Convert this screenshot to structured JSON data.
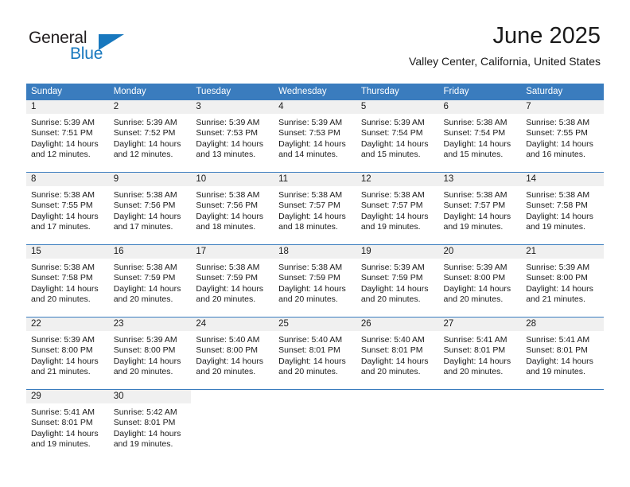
{
  "brand": {
    "name_part1": "General",
    "name_part2": "Blue",
    "triangle_icon": "triangle-icon"
  },
  "header": {
    "month_title": "June 2025",
    "location": "Valley Center, California, United States"
  },
  "calendar": {
    "weekday_headers": [
      "Sunday",
      "Monday",
      "Tuesday",
      "Wednesday",
      "Thursday",
      "Friday",
      "Saturday"
    ],
    "colors": {
      "header_background": "#3a7cbe",
      "header_text": "#ffffff",
      "daynum_background": "#f0f0f0",
      "cell_background": "#ffffff",
      "row_divider": "#3a7cbe",
      "brand_blue": "#1878be",
      "text": "#1a1a1a"
    },
    "weeks": [
      [
        {
          "day": "1",
          "sunrise": "Sunrise: 5:39 AM",
          "sunset": "Sunset: 7:51 PM",
          "daylight": "Daylight: 14 hours and 12 minutes."
        },
        {
          "day": "2",
          "sunrise": "Sunrise: 5:39 AM",
          "sunset": "Sunset: 7:52 PM",
          "daylight": "Daylight: 14 hours and 12 minutes."
        },
        {
          "day": "3",
          "sunrise": "Sunrise: 5:39 AM",
          "sunset": "Sunset: 7:53 PM",
          "daylight": "Daylight: 14 hours and 13 minutes."
        },
        {
          "day": "4",
          "sunrise": "Sunrise: 5:39 AM",
          "sunset": "Sunset: 7:53 PM",
          "daylight": "Daylight: 14 hours and 14 minutes."
        },
        {
          "day": "5",
          "sunrise": "Sunrise: 5:39 AM",
          "sunset": "Sunset: 7:54 PM",
          "daylight": "Daylight: 14 hours and 15 minutes."
        },
        {
          "day": "6",
          "sunrise": "Sunrise: 5:38 AM",
          "sunset": "Sunset: 7:54 PM",
          "daylight": "Daylight: 14 hours and 15 minutes."
        },
        {
          "day": "7",
          "sunrise": "Sunrise: 5:38 AM",
          "sunset": "Sunset: 7:55 PM",
          "daylight": "Daylight: 14 hours and 16 minutes."
        }
      ],
      [
        {
          "day": "8",
          "sunrise": "Sunrise: 5:38 AM",
          "sunset": "Sunset: 7:55 PM",
          "daylight": "Daylight: 14 hours and 17 minutes."
        },
        {
          "day": "9",
          "sunrise": "Sunrise: 5:38 AM",
          "sunset": "Sunset: 7:56 PM",
          "daylight": "Daylight: 14 hours and 17 minutes."
        },
        {
          "day": "10",
          "sunrise": "Sunrise: 5:38 AM",
          "sunset": "Sunset: 7:56 PM",
          "daylight": "Daylight: 14 hours and 18 minutes."
        },
        {
          "day": "11",
          "sunrise": "Sunrise: 5:38 AM",
          "sunset": "Sunset: 7:57 PM",
          "daylight": "Daylight: 14 hours and 18 minutes."
        },
        {
          "day": "12",
          "sunrise": "Sunrise: 5:38 AM",
          "sunset": "Sunset: 7:57 PM",
          "daylight": "Daylight: 14 hours and 19 minutes."
        },
        {
          "day": "13",
          "sunrise": "Sunrise: 5:38 AM",
          "sunset": "Sunset: 7:57 PM",
          "daylight": "Daylight: 14 hours and 19 minutes."
        },
        {
          "day": "14",
          "sunrise": "Sunrise: 5:38 AM",
          "sunset": "Sunset: 7:58 PM",
          "daylight": "Daylight: 14 hours and 19 minutes."
        }
      ],
      [
        {
          "day": "15",
          "sunrise": "Sunrise: 5:38 AM",
          "sunset": "Sunset: 7:58 PM",
          "daylight": "Daylight: 14 hours and 20 minutes."
        },
        {
          "day": "16",
          "sunrise": "Sunrise: 5:38 AM",
          "sunset": "Sunset: 7:59 PM",
          "daylight": "Daylight: 14 hours and 20 minutes."
        },
        {
          "day": "17",
          "sunrise": "Sunrise: 5:38 AM",
          "sunset": "Sunset: 7:59 PM",
          "daylight": "Daylight: 14 hours and 20 minutes."
        },
        {
          "day": "18",
          "sunrise": "Sunrise: 5:38 AM",
          "sunset": "Sunset: 7:59 PM",
          "daylight": "Daylight: 14 hours and 20 minutes."
        },
        {
          "day": "19",
          "sunrise": "Sunrise: 5:39 AM",
          "sunset": "Sunset: 7:59 PM",
          "daylight": "Daylight: 14 hours and 20 minutes."
        },
        {
          "day": "20",
          "sunrise": "Sunrise: 5:39 AM",
          "sunset": "Sunset: 8:00 PM",
          "daylight": "Daylight: 14 hours and 20 minutes."
        },
        {
          "day": "21",
          "sunrise": "Sunrise: 5:39 AM",
          "sunset": "Sunset: 8:00 PM",
          "daylight": "Daylight: 14 hours and 21 minutes."
        }
      ],
      [
        {
          "day": "22",
          "sunrise": "Sunrise: 5:39 AM",
          "sunset": "Sunset: 8:00 PM",
          "daylight": "Daylight: 14 hours and 21 minutes."
        },
        {
          "day": "23",
          "sunrise": "Sunrise: 5:39 AM",
          "sunset": "Sunset: 8:00 PM",
          "daylight": "Daylight: 14 hours and 20 minutes."
        },
        {
          "day": "24",
          "sunrise": "Sunrise: 5:40 AM",
          "sunset": "Sunset: 8:00 PM",
          "daylight": "Daylight: 14 hours and 20 minutes."
        },
        {
          "day": "25",
          "sunrise": "Sunrise: 5:40 AM",
          "sunset": "Sunset: 8:01 PM",
          "daylight": "Daylight: 14 hours and 20 minutes."
        },
        {
          "day": "26",
          "sunrise": "Sunrise: 5:40 AM",
          "sunset": "Sunset: 8:01 PM",
          "daylight": "Daylight: 14 hours and 20 minutes."
        },
        {
          "day": "27",
          "sunrise": "Sunrise: 5:41 AM",
          "sunset": "Sunset: 8:01 PM",
          "daylight": "Daylight: 14 hours and 20 minutes."
        },
        {
          "day": "28",
          "sunrise": "Sunrise: 5:41 AM",
          "sunset": "Sunset: 8:01 PM",
          "daylight": "Daylight: 14 hours and 19 minutes."
        }
      ],
      [
        {
          "day": "29",
          "sunrise": "Sunrise: 5:41 AM",
          "sunset": "Sunset: 8:01 PM",
          "daylight": "Daylight: 14 hours and 19 minutes."
        },
        {
          "day": "30",
          "sunrise": "Sunrise: 5:42 AM",
          "sunset": "Sunset: 8:01 PM",
          "daylight": "Daylight: 14 hours and 19 minutes."
        },
        {
          "day": "",
          "sunrise": "",
          "sunset": "",
          "daylight": ""
        },
        {
          "day": "",
          "sunrise": "",
          "sunset": "",
          "daylight": ""
        },
        {
          "day": "",
          "sunrise": "",
          "sunset": "",
          "daylight": ""
        },
        {
          "day": "",
          "sunrise": "",
          "sunset": "",
          "daylight": ""
        },
        {
          "day": "",
          "sunrise": "",
          "sunset": "",
          "daylight": ""
        }
      ]
    ]
  }
}
